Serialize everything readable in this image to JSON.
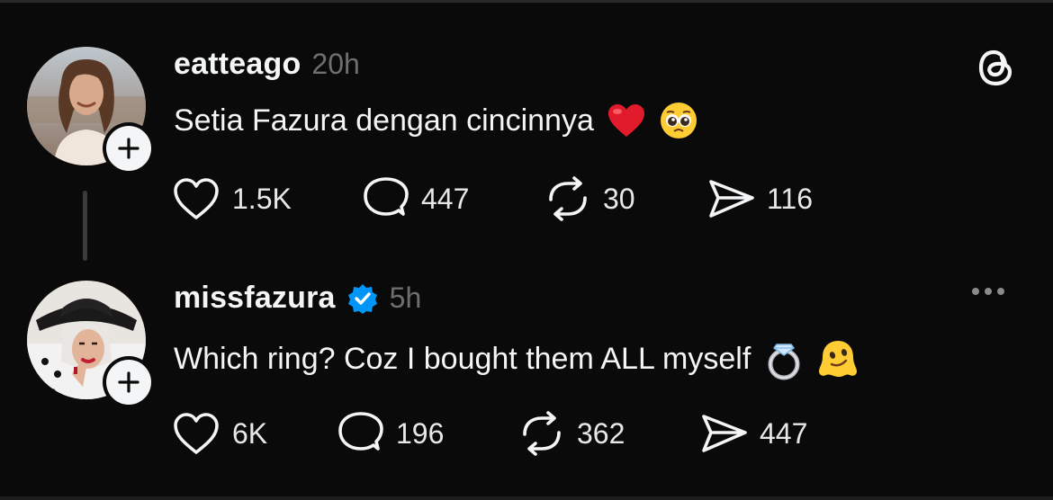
{
  "posts": [
    {
      "username": "eatteago",
      "time": "20h",
      "verified": false,
      "text": "Setia Fazura dengan cincinnya",
      "emojis": [
        "red-heart-emoji",
        "pleading-face-emoji"
      ],
      "likes": "1.5K",
      "replies": "447",
      "reposts": "30",
      "shares": "116"
    },
    {
      "username": "missfazura",
      "time": "5h",
      "verified": true,
      "text": "Which ring? Coz I bought them ALL myself",
      "emojis": [
        "ring-emoji",
        "melting-face-emoji"
      ],
      "likes": "6K",
      "replies": "196",
      "reposts": "362",
      "shares": "447"
    }
  ],
  "icons": {
    "like": "heart-icon",
    "reply": "comment-bubble-icon",
    "repost": "repost-icon",
    "share": "send-icon",
    "app": "threads-logo-icon",
    "more": "more-horizontal-icon"
  },
  "colors": {
    "background": "#0a0a0a",
    "text": "#f3f5f7",
    "muted": "#6f6f6f",
    "verified": "#0095f6"
  }
}
